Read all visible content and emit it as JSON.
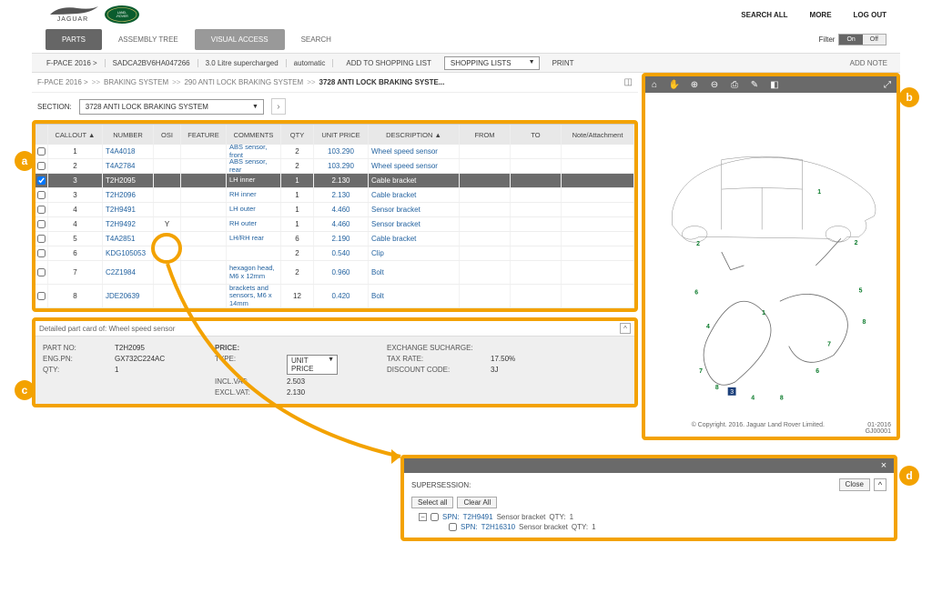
{
  "header": {
    "links": [
      "SEARCH ALL",
      "MORE",
      "LOG OUT"
    ],
    "logo_jag": "JAGUAR",
    "logo_lr": "LAND ROVER"
  },
  "nav": {
    "parts": "PARTS",
    "assembly": "ASSEMBLY TREE",
    "visual": "VISUAL ACCESS",
    "search": "SEARCH",
    "filter_label": "Filter",
    "filter_on": "On",
    "filter_off": "Off"
  },
  "context": {
    "vehicle": "F-PACE 2016 >",
    "vin": "SADCA2BV6HA047266",
    "engine": "3.0 Litre supercharged",
    "trans": "automatic",
    "add_shopping": "ADD TO SHOPPING LIST",
    "shopping_lists": "SHOPPING LISTS",
    "print": "PRINT",
    "add_note": "ADD NOTE"
  },
  "breadcrumb": {
    "a": "F-PACE 2016 >",
    "b": "BRAKING SYSTEM",
    "c": "290 ANTI LOCK BRAKING SYSTEM",
    "d": "3728 ANTI LOCK BRAKING SYSTE...",
    "sep": ">>"
  },
  "section": {
    "label": "SECTION:",
    "value": "3728 ANTI LOCK BRAKING SYSTEM"
  },
  "table": {
    "headers": [
      "",
      "CALLOUT ▲",
      "NUMBER",
      "OSI",
      "FEATURE",
      "COMMENTS",
      "QTY",
      "UNIT PRICE",
      "DESCRIPTION ▲",
      "FROM",
      "TO",
      "Note/Attachment"
    ],
    "rows": [
      {
        "callout": "1",
        "number": "T4A4018",
        "osi": "",
        "comments": "ABS sensor, front",
        "qty": "2",
        "price": "103.290",
        "desc": "Wheel speed sensor",
        "selected": false
      },
      {
        "callout": "2",
        "number": "T4A2784",
        "osi": "",
        "comments": "ABS sensor, rear",
        "qty": "2",
        "price": "103.290",
        "desc": "Wheel speed sensor",
        "selected": false
      },
      {
        "callout": "3",
        "number": "T2H2095",
        "osi": "",
        "comments": "LH inner",
        "qty": "1",
        "price": "2.130",
        "desc": "Cable bracket",
        "selected": true
      },
      {
        "callout": "3",
        "number": "T2H2096",
        "osi": "",
        "comments": "RH inner",
        "qty": "1",
        "price": "2.130",
        "desc": "Cable bracket",
        "selected": false
      },
      {
        "callout": "4",
        "number": "T2H9491",
        "osi": "",
        "comments": "LH outer",
        "qty": "1",
        "price": "4.460",
        "desc": "Sensor bracket",
        "selected": false
      },
      {
        "callout": "4",
        "number": "T2H9492",
        "osi": "Y",
        "comments": "RH outer",
        "qty": "1",
        "price": "4.460",
        "desc": "Sensor bracket",
        "selected": false
      },
      {
        "callout": "5",
        "number": "T4A2851",
        "osi": "",
        "comments": "LH/RH rear",
        "qty": "6",
        "price": "2.190",
        "desc": "Cable bracket",
        "selected": false
      },
      {
        "callout": "6",
        "number": "KDG105053",
        "osi": "",
        "comments": "",
        "qty": "2",
        "price": "0.540",
        "desc": "Clip",
        "selected": false
      },
      {
        "callout": "7",
        "number": "C2Z1984",
        "osi": "",
        "comments": "hexagon head, M6 x 12mm",
        "qty": "2",
        "price": "0.960",
        "desc": "Bolt",
        "selected": false,
        "multi": true
      },
      {
        "callout": "8",
        "number": "JDE20639",
        "osi": "",
        "comments": "brackets and sensors, M6 x 14mm",
        "qty": "12",
        "price": "0.420",
        "desc": "Bolt",
        "selected": false,
        "multi": true
      }
    ]
  },
  "detail": {
    "title": "Detailed part card of: Wheel speed sensor",
    "left": {
      "partno_l": "PART NO:",
      "partno_v": "T2H2095",
      "engpn_l": "ENG.PN:",
      "engpn_v": "GX732C224AC",
      "qty_l": "QTY:",
      "qty_v": "1"
    },
    "price": {
      "price_l": "PRICE:",
      "type_l": "TYPE:",
      "type_v": "UNIT PRICE",
      "incl_l": "INCL.VAT:",
      "incl_v": "2.503",
      "excl_l": "EXCL.VAT:",
      "excl_v": "2.130"
    },
    "right": {
      "exs_l": "EXCHANGE SUCHARGE:",
      "tax_l": "TAX RATE:",
      "tax_v": "17.50%",
      "disc_l": "DISCOUNT CODE:",
      "disc_v": "3J"
    }
  },
  "viewer": {
    "copyright": "© Copyright. 2016. Jaguar Land Rover Limited.",
    "date": "01-2016",
    "code": "GJ00001"
  },
  "popup": {
    "title": "SUPERSESSION:",
    "close": "Close",
    "select_all": "Select all",
    "clear_all": "Clear All",
    "tree": [
      {
        "level": 0,
        "spn": "SPN:",
        "num": "T2H9491",
        "desc": "Sensor bracket",
        "qty_l": "QTY:",
        "qty": "1",
        "toggle": "−"
      },
      {
        "level": 1,
        "spn": "SPN:",
        "num": "T2H16310",
        "desc": "Sensor bracket",
        "qty_l": "QTY:",
        "qty": "1"
      }
    ]
  },
  "ann": {
    "a": "a",
    "b": "b",
    "c": "c",
    "d": "d"
  }
}
